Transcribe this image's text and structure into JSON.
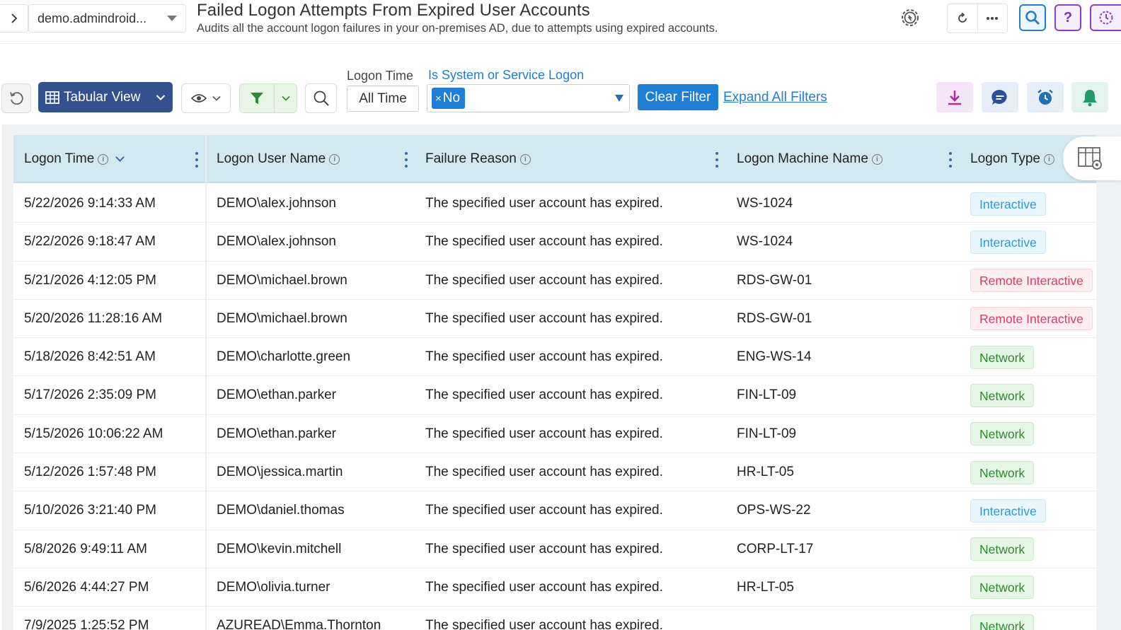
{
  "header": {
    "domain": "demo.admindroid...",
    "title": "Failed Logon Attempts From Expired User Accounts",
    "subtitle": "Audits all the account logon failures in your on-premises AD, due to attempts using expired accounts.",
    "help_label": "?"
  },
  "toolbar": {
    "view_label": "Tabular View",
    "filters": {
      "logon_time_label": "Logon Time",
      "logon_time_value": "All Time",
      "system_logon_label": "Is System or Service Logon",
      "system_logon_chip": "No",
      "chip_remove": "×"
    },
    "clear_filter_label": "Clear Filter",
    "expand_filters_label": "Expand All Filters"
  },
  "table": {
    "columns": [
      "Logon Time",
      "Logon User Name",
      "Failure Reason",
      "Logon Machine Name",
      "Logon Type"
    ],
    "rows": [
      {
        "time": "5/22/2026 9:14:33 AM",
        "user": "DEMO\\alex.johnson",
        "reason": "The specified user account has expired.",
        "machine": "WS-1024",
        "type": "Interactive"
      },
      {
        "time": "5/22/2026 9:18:47 AM",
        "user": "DEMO\\alex.johnson",
        "reason": "The specified user account has expired.",
        "machine": "WS-1024",
        "type": "Interactive"
      },
      {
        "time": "5/21/2026 4:12:05 PM",
        "user": "DEMO\\michael.brown",
        "reason": "The specified user account has expired.",
        "machine": "RDS-GW-01",
        "type": "Remote Interactive"
      },
      {
        "time": "5/20/2026 11:28:16 AM",
        "user": "DEMO\\michael.brown",
        "reason": "The specified user account has expired.",
        "machine": "RDS-GW-01",
        "type": "Remote Interactive"
      },
      {
        "time": "5/18/2026 8:42:51 AM",
        "user": "DEMO\\charlotte.green",
        "reason": "The specified user account has expired.",
        "machine": "ENG-WS-14",
        "type": "Network"
      },
      {
        "time": "5/17/2026 2:35:09 PM",
        "user": "DEMO\\ethan.parker",
        "reason": "The specified user account has expired.",
        "machine": "FIN-LT-09",
        "type": "Network"
      },
      {
        "time": "5/15/2026 10:06:22 AM",
        "user": "DEMO\\ethan.parker",
        "reason": "The specified user account has expired.",
        "machine": "FIN-LT-09",
        "type": "Network"
      },
      {
        "time": "5/12/2026 1:57:48 PM",
        "user": "DEMO\\jessica.martin",
        "reason": "The specified user account has expired.",
        "machine": "HR-LT-05",
        "type": "Network"
      },
      {
        "time": "5/10/2026 3:21:40 PM",
        "user": "DEMO\\daniel.thomas",
        "reason": "The specified user account has expired.",
        "machine": "OPS-WS-22",
        "type": "Interactive"
      },
      {
        "time": "5/8/2026 9:49:11 AM",
        "user": "DEMO\\kevin.mitchell",
        "reason": "The specified user account has expired.",
        "machine": "CORP-LT-17",
        "type": "Network"
      },
      {
        "time": "5/6/2026 4:44:27 PM",
        "user": "DEMO\\olivia.turner",
        "reason": "The specified user account has expired.",
        "machine": "HR-LT-05",
        "type": "Network"
      },
      {
        "time": "7/9/2025 1:25:52 PM",
        "user": "AZUREAD\\Emma.Thornton",
        "reason": "The specified user account has expired.",
        "machine": "",
        "type": "Network"
      }
    ]
  },
  "colors": {
    "primary_blue": "#1f7fd6",
    "view_button": "#34518f",
    "header_row": "#d3e9f1",
    "interactive": "#2d9ad6",
    "remote_interactive": "#d43f66",
    "network": "#2f8a2f"
  },
  "icons": {
    "nav": "chevron-right-icon",
    "settings": "gear-bulb-icon",
    "refresh": "refresh-icon",
    "more": "more-icon",
    "search": "search-icon",
    "help": "help-icon",
    "schedule": "clock-icon",
    "reset": "reset-icon",
    "view": "table-icon",
    "visibility": "eye-icon",
    "filter": "filter-icon",
    "export": "download-icon",
    "share": "chat-icon",
    "alarm": "alarm-icon",
    "alert": "bell-icon",
    "columns": "column-settings-icon"
  }
}
